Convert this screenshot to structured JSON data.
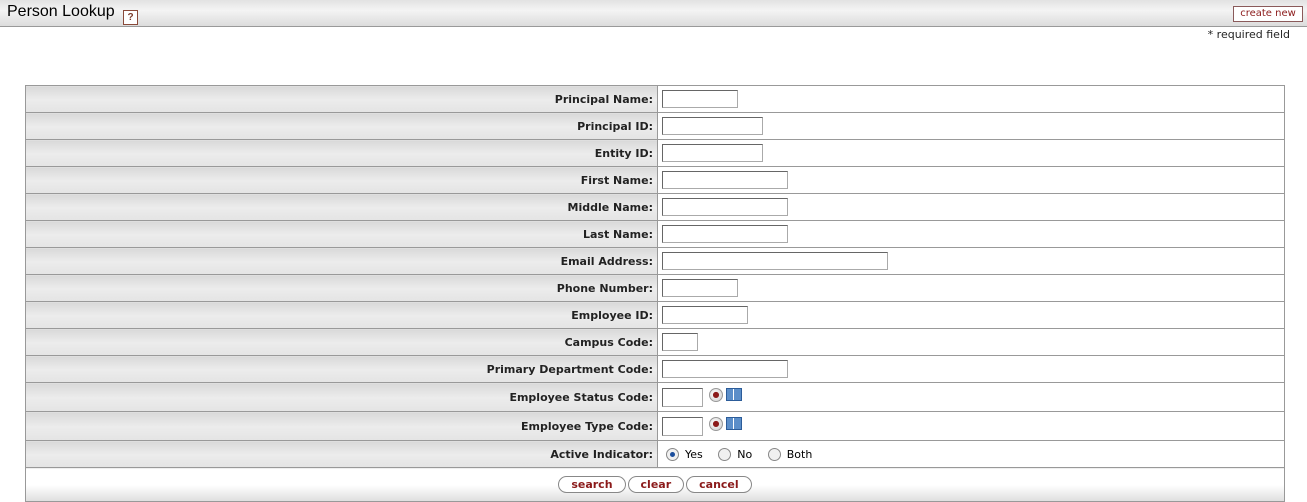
{
  "header": {
    "title": "Person Lookup",
    "help_icon": "help-icon",
    "create_new_label": "create new"
  },
  "required_note": "* required field",
  "fields": [
    {
      "label": "Principal Name:",
      "value": ""
    },
    {
      "label": "Principal ID:",
      "value": ""
    },
    {
      "label": "Entity ID:",
      "value": ""
    },
    {
      "label": "First Name:",
      "value": ""
    },
    {
      "label": "Middle Name:",
      "value": ""
    },
    {
      "label": "Last Name:",
      "value": ""
    },
    {
      "label": "Email Address:",
      "value": ""
    },
    {
      "label": "Phone Number:",
      "value": ""
    },
    {
      "label": "Employee ID:",
      "value": ""
    },
    {
      "label": "Campus Code:",
      "value": ""
    },
    {
      "label": "Primary Department Code:",
      "value": ""
    },
    {
      "label": "Employee Status Code:",
      "value": ""
    },
    {
      "label": "Employee Type Code:",
      "value": ""
    }
  ],
  "active_indicator": {
    "label": "Active Indicator:",
    "options": [
      "Yes",
      "No",
      "Both"
    ],
    "selected": "Yes"
  },
  "buttons": {
    "search": "search",
    "clear": "clear",
    "cancel": "cancel"
  }
}
